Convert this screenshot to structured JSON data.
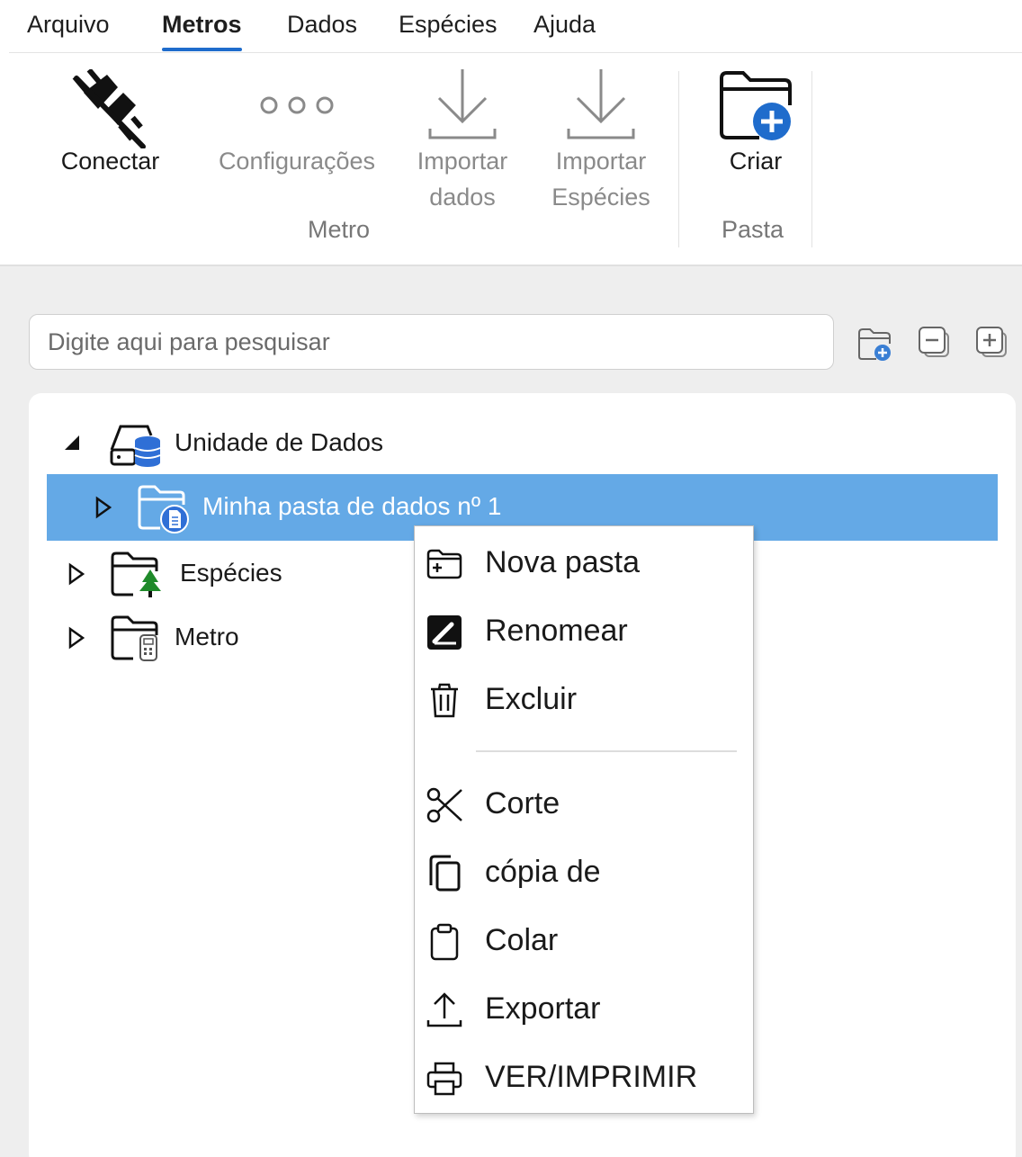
{
  "menu": {
    "tabs": [
      {
        "label": "Arquivo"
      },
      {
        "label": "Metros"
      },
      {
        "label": "Dados"
      },
      {
        "label": "Espécies"
      },
      {
        "label": "Ajuda"
      }
    ],
    "active_tab": "Metros"
  },
  "ribbon": {
    "connect": {
      "label": "Conectar",
      "icon": "plug-disconnected-icon"
    },
    "settings": {
      "label": "Configurações",
      "icon": "more-dots-icon"
    },
    "import_data": {
      "line1": "Importar",
      "line2": "dados",
      "icon": "download-arrow-icon"
    },
    "import_species": {
      "line1": "Importar",
      "line2": "Espécies",
      "icon": "download-arrow-icon"
    },
    "create": {
      "label": "Criar",
      "icon": "folder-add-icon"
    },
    "group_metro": "Metro",
    "group_pasta": "Pasta"
  },
  "search": {
    "placeholder": "Digite aqui para pesquisar"
  },
  "tree": {
    "root": {
      "label": "Unidade de Dados",
      "icon": "data-drive-icon"
    },
    "items": [
      {
        "label": "Minha pasta de dados nº 1",
        "icon": "folder-document-icon",
        "selected": true
      },
      {
        "label": "Espécies",
        "icon": "folder-tree-icon"
      },
      {
        "label": "Metro",
        "icon": "folder-meter-icon"
      }
    ]
  },
  "context_menu": {
    "items": [
      {
        "label": "Nova pasta",
        "icon": "folder-add-icon"
      },
      {
        "label": "Renomear",
        "icon": "rename-icon"
      },
      {
        "label": "Excluir",
        "icon": "trash-icon"
      },
      {
        "label": "Corte",
        "icon": "scissors-icon"
      },
      {
        "label": "cópia de",
        "icon": "copy-icon"
      },
      {
        "label": "Colar",
        "icon": "clipboard-icon"
      },
      {
        "label": "Exportar",
        "icon": "export-icon"
      },
      {
        "label": "VER/IMPRIMIR",
        "icon": "printer-icon"
      }
    ]
  },
  "colors": {
    "accent": "#1f6ccc",
    "selection": "#64a9e6",
    "database_blue": "#2f6fd6",
    "tree_green": "#1f8a2a"
  }
}
